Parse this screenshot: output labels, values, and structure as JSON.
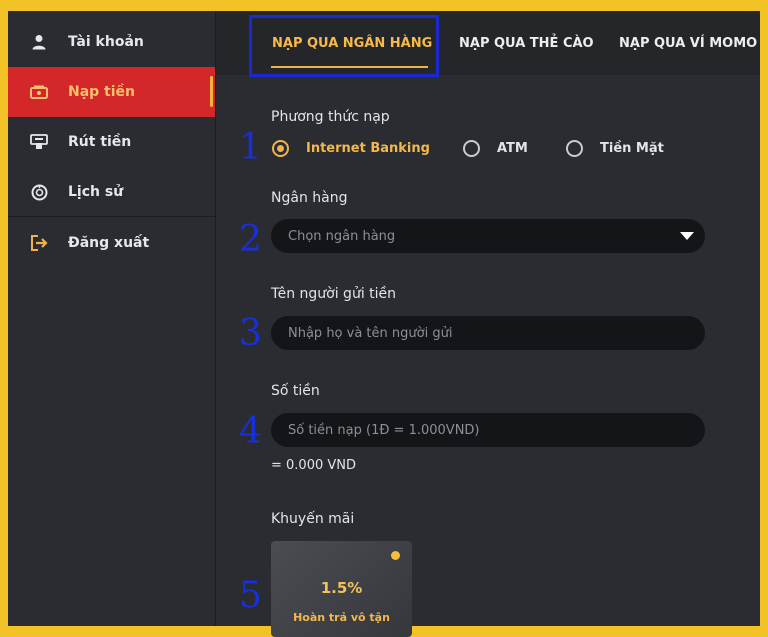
{
  "sidebar": {
    "items": [
      {
        "label": "Tài khoản",
        "icon": "user-icon"
      },
      {
        "label": "Nạp tiền",
        "icon": "wallet-icon",
        "active": true
      },
      {
        "label": "Rút tiền",
        "icon": "atm-icon"
      },
      {
        "label": "Lịch sử",
        "icon": "history-icon"
      },
      {
        "label": "Đăng xuất",
        "icon": "logout-icon"
      }
    ]
  },
  "tabs": [
    {
      "label": "NẠP QUA NGÂN HÀNG",
      "active": true
    },
    {
      "label": "NẠP QUA THẺ CÀO"
    },
    {
      "label": "NẠP QUA VÍ MOMO"
    }
  ],
  "form": {
    "method_label": "Phương thức nạp",
    "methods": [
      {
        "label": "Internet Banking",
        "checked": true
      },
      {
        "label": "ATM"
      },
      {
        "label": "Tiền Mặt"
      }
    ],
    "bank_label": "Ngân hàng",
    "bank_placeholder": "Chọn ngân hàng",
    "sender_label": "Tên người gửi tiền",
    "sender_placeholder": "Nhập họ và tên người gửi",
    "amount_label": "Số tiền",
    "amount_placeholder": "Số tiền nạp (1Đ = 1.000VND)",
    "amount_converted": "= 0.000 VND",
    "promo_label": "Khuyến mãi",
    "promo": {
      "percent": "1.5%",
      "desc": "Hoàn trả vô tận"
    }
  },
  "annotations": [
    "1",
    "2",
    "3",
    "4",
    "5"
  ],
  "colors": {
    "accent": "#f0b24a",
    "active_bg": "#d3272a",
    "annotation": "#1830d8",
    "panel": "#2a2c31",
    "border": "#f2c227"
  }
}
